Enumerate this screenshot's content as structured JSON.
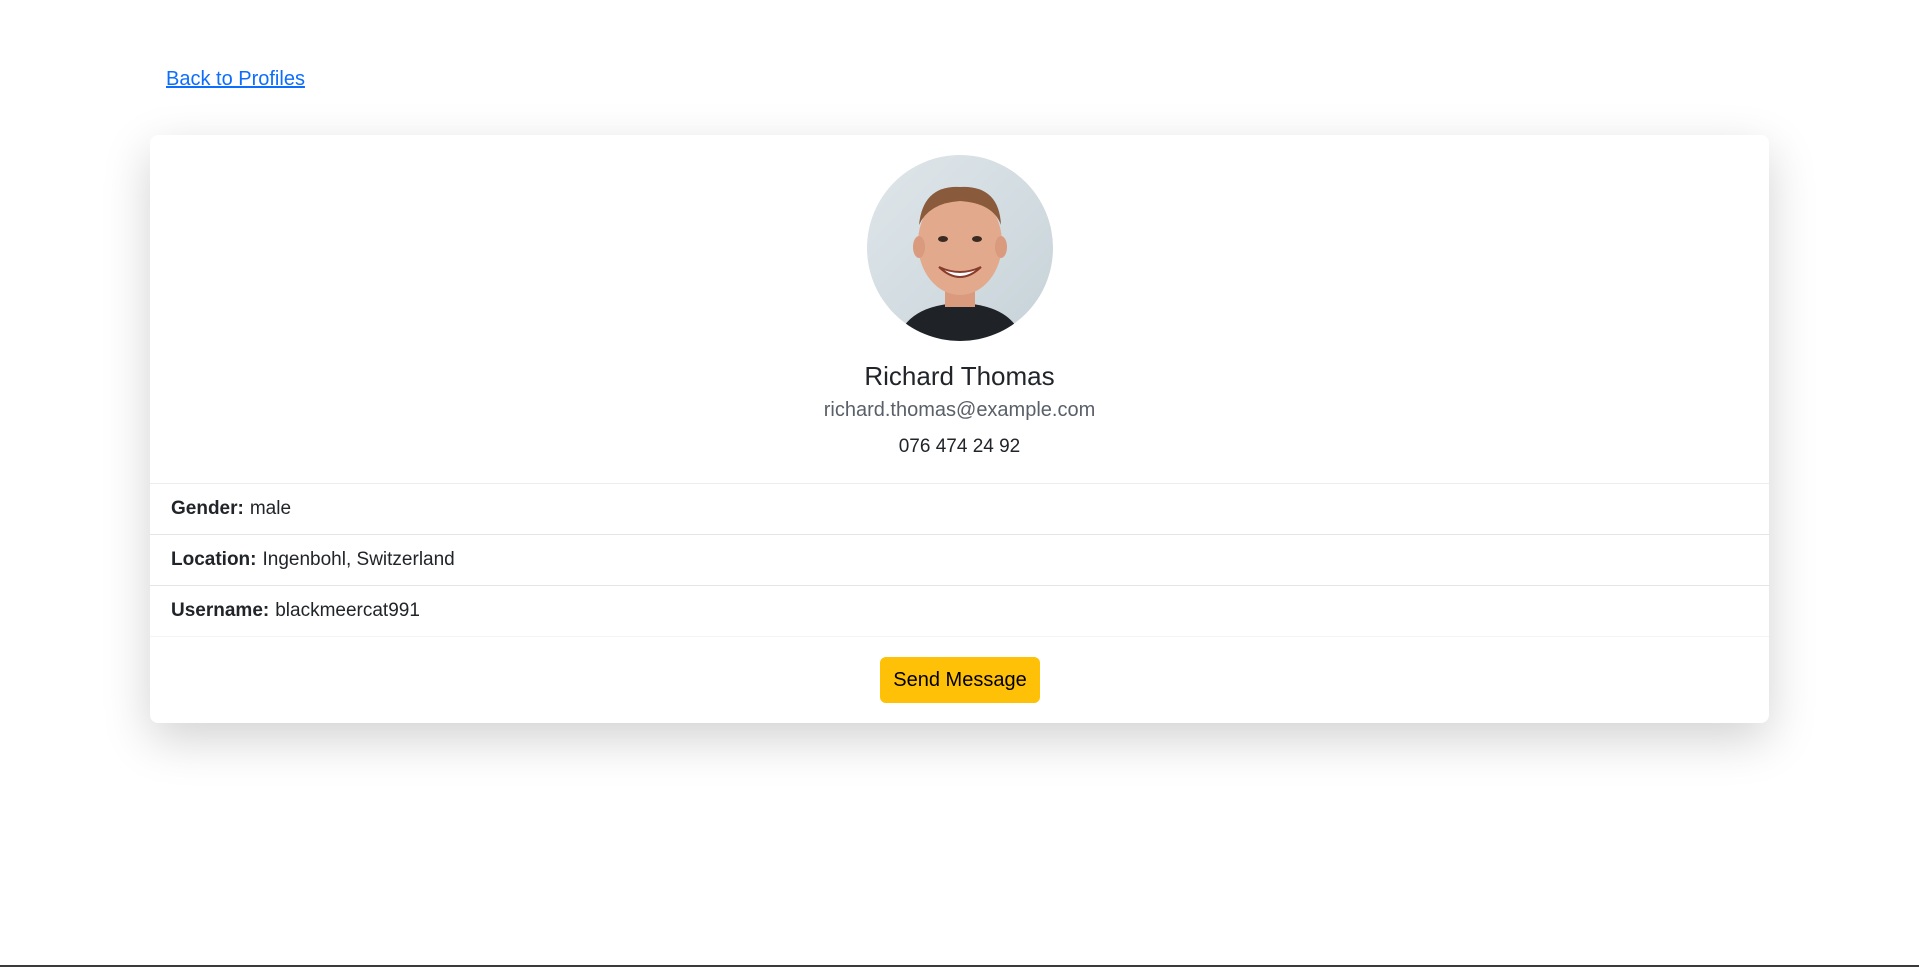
{
  "nav": {
    "back_label": "Back to Profiles"
  },
  "profile": {
    "avatar_icon": "profile-photo",
    "name": "Richard Thomas",
    "email": "richard.thomas@example.com",
    "phone": "076 474 24 92",
    "details": [
      {
        "label": "Gender:",
        "value": "male"
      },
      {
        "label": "Location:",
        "value": "Ingenbohl, Switzerland"
      },
      {
        "label": "Username:",
        "value": "blackmeercat991"
      }
    ]
  },
  "actions": {
    "send_label": "Send Message"
  },
  "colors": {
    "link": "#0d6efd",
    "button": "#ffc107"
  }
}
